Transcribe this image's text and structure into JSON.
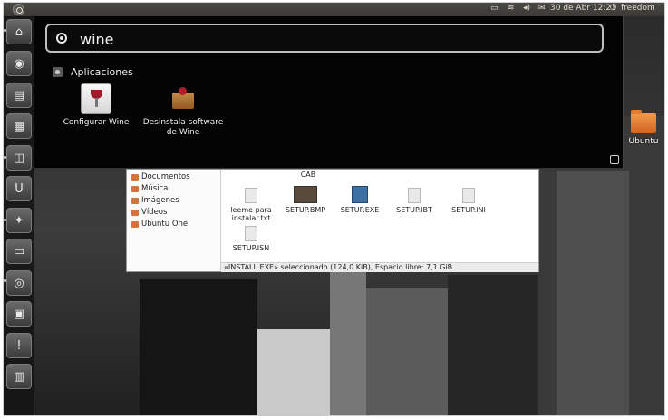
{
  "top_panel": {
    "date_time": "30 de Abr 12:21",
    "user": "freedom"
  },
  "dash": {
    "search_value": "wine",
    "section_title": "Aplicaciones",
    "apps": [
      {
        "label": "Configurar Wine"
      },
      {
        "label": "Desinstala software de Wine"
      }
    ]
  },
  "desktop": {
    "folder_label": "Ubuntu"
  },
  "file_manager": {
    "sidebar": [
      "Documentos",
      "Música",
      "Imágenes",
      "Vídeos",
      "Ubuntu One"
    ],
    "top_cut_label": "CAB",
    "files": [
      {
        "name": "leeme para instalar.txt",
        "icon": "text-file-icon"
      },
      {
        "name": "SETUP.BMP",
        "icon": "image-file-icon"
      },
      {
        "name": "SETUP.EXE",
        "icon": "exe-file-icon"
      },
      {
        "name": "SETUP.IBT",
        "icon": "generic-file-icon"
      },
      {
        "name": "SETUP.INI",
        "icon": "text-file-icon"
      },
      {
        "name": "SETUP.ISN",
        "icon": "generic-file-icon"
      }
    ],
    "status": "«INSTALL.EXE» seleccionado (124,0 KiB), Espacio libre: 7,1 GiB"
  }
}
